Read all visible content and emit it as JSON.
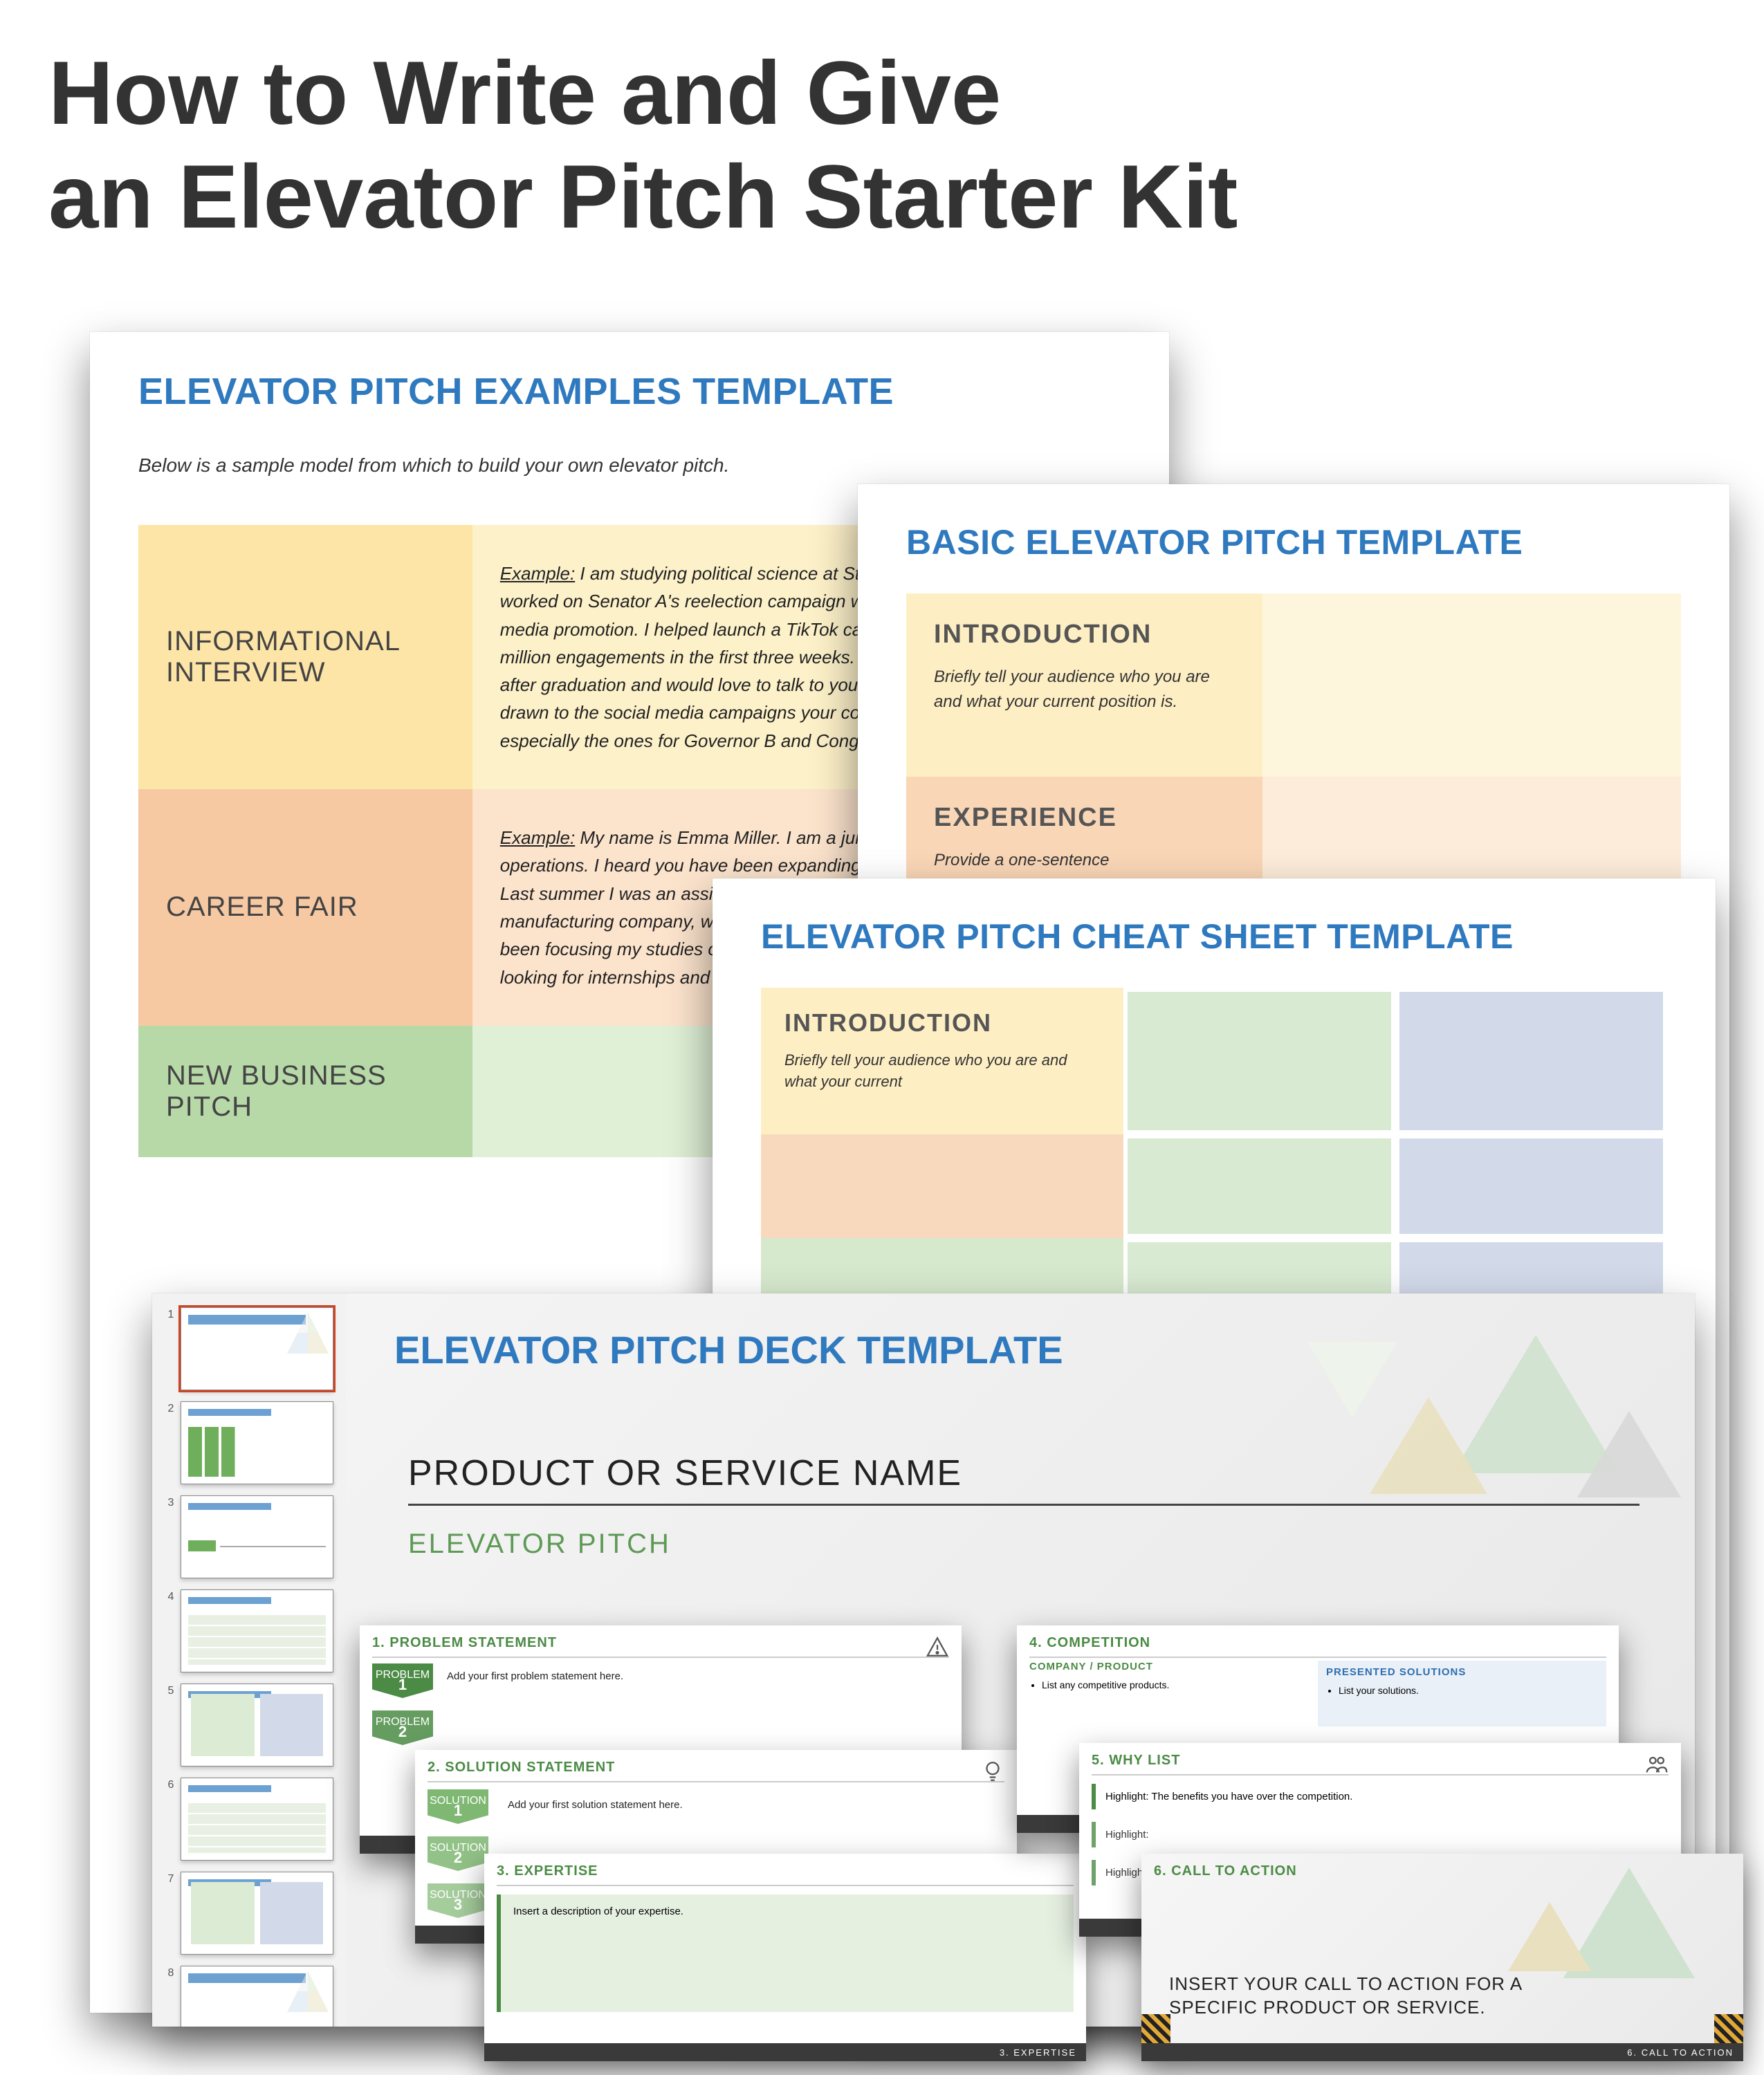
{
  "page": {
    "title": "How to Write and Give\nan Elevator Pitch Starter Kit"
  },
  "examples": {
    "heading": "ELEVATOR PITCH EXAMPLES TEMPLATE",
    "sub": "Below is a sample model from which to build your own elevator pitch.",
    "rows": [
      {
        "label": "INFORMATIONAL INTERVIEW",
        "body": "Example: I am studying political science at State U. This summer, I worked on Senator A's reelection campaign where I focused on social media promotion. I helped launch a TikTok campaign that got over six million engagements in the first three weeks. I want to continue doing this after graduation and would love to talk to you about your work. I am really drawn to the social media campaigns your company has spearheaded, especially the ones for Governor B and Congresswoman C."
      },
      {
        "label": "CAREER FAIR",
        "body": "Example: My name is Emma Miller. I am a junior studying business operations. I heard you have been expanding your vertical supply chain. Last summer I was an assistant operations manager at a clothing manufacturing company, where I worked on vertical integrations. I have been focusing my studies on process and systems optimization and am looking for internships and jobs where I can put that to use."
      },
      {
        "label": "NEW BUSINESS PITCH",
        "body": ""
      }
    ]
  },
  "basic": {
    "heading": "BASIC ELEVATOR PITCH TEMPLATE",
    "sections": [
      {
        "title": "INTRODUCTION",
        "desc": "Briefly tell your audience who you are and what your current position is."
      },
      {
        "title": "EXPERIENCE",
        "desc": "Provide a one-sentence"
      }
    ]
  },
  "cheat": {
    "heading": "ELEVATOR PITCH CHEAT SHEET TEMPLATE",
    "intro": {
      "title": "INTRODUCTION",
      "desc": "Briefly tell your audience who you are and what your current"
    }
  },
  "deck": {
    "heading": "ELEVATOR PITCH DECK TEMPLATE",
    "product": "PRODUCT OR SERVICE NAME",
    "subtitle": "ELEVATOR PITCH",
    "thumbs": [
      "1",
      "2",
      "3",
      "4",
      "5",
      "6",
      "7",
      "8"
    ],
    "ms1": {
      "title": "1. PROBLEM STATEMENT",
      "chip1": "PROBLEM",
      "n1": "1",
      "chip2": "PROBLEM",
      "n2": "2",
      "line": "Add your first problem statement here."
    },
    "ms2": {
      "title": "2. SOLUTION STATEMENT",
      "chip1": "SOLUTION",
      "n1": "1",
      "chip2": "SOLUTION",
      "n2": "2",
      "chip3": "SOLUTION",
      "n3": "3",
      "line": "Add your first solution statement here."
    },
    "ms3": {
      "title": "3. EXPERTISE",
      "line": "Insert a description of your expertise.",
      "foot": "3. EXPERTISE"
    },
    "ms4": {
      "title": "4. COMPETITION",
      "colA": "COMPANY / PRODUCT",
      "colB": "PRESENTED SOLUTIONS",
      "liA": "List any competitive products.",
      "liB": "List your solutions."
    },
    "ms5": {
      "title": "5. WHY LIST",
      "hl1": "Highlight: The benefits you have over the competition.",
      "hl2": "Highlight:",
      "hl3": "Highlight:"
    },
    "ms6": {
      "title": "6. CALL TO ACTION",
      "msg": "INSERT YOUR CALL TO ACTION FOR A SPECIFIC PRODUCT OR SERVICE.",
      "foot": "6. CALL TO ACTION"
    }
  }
}
